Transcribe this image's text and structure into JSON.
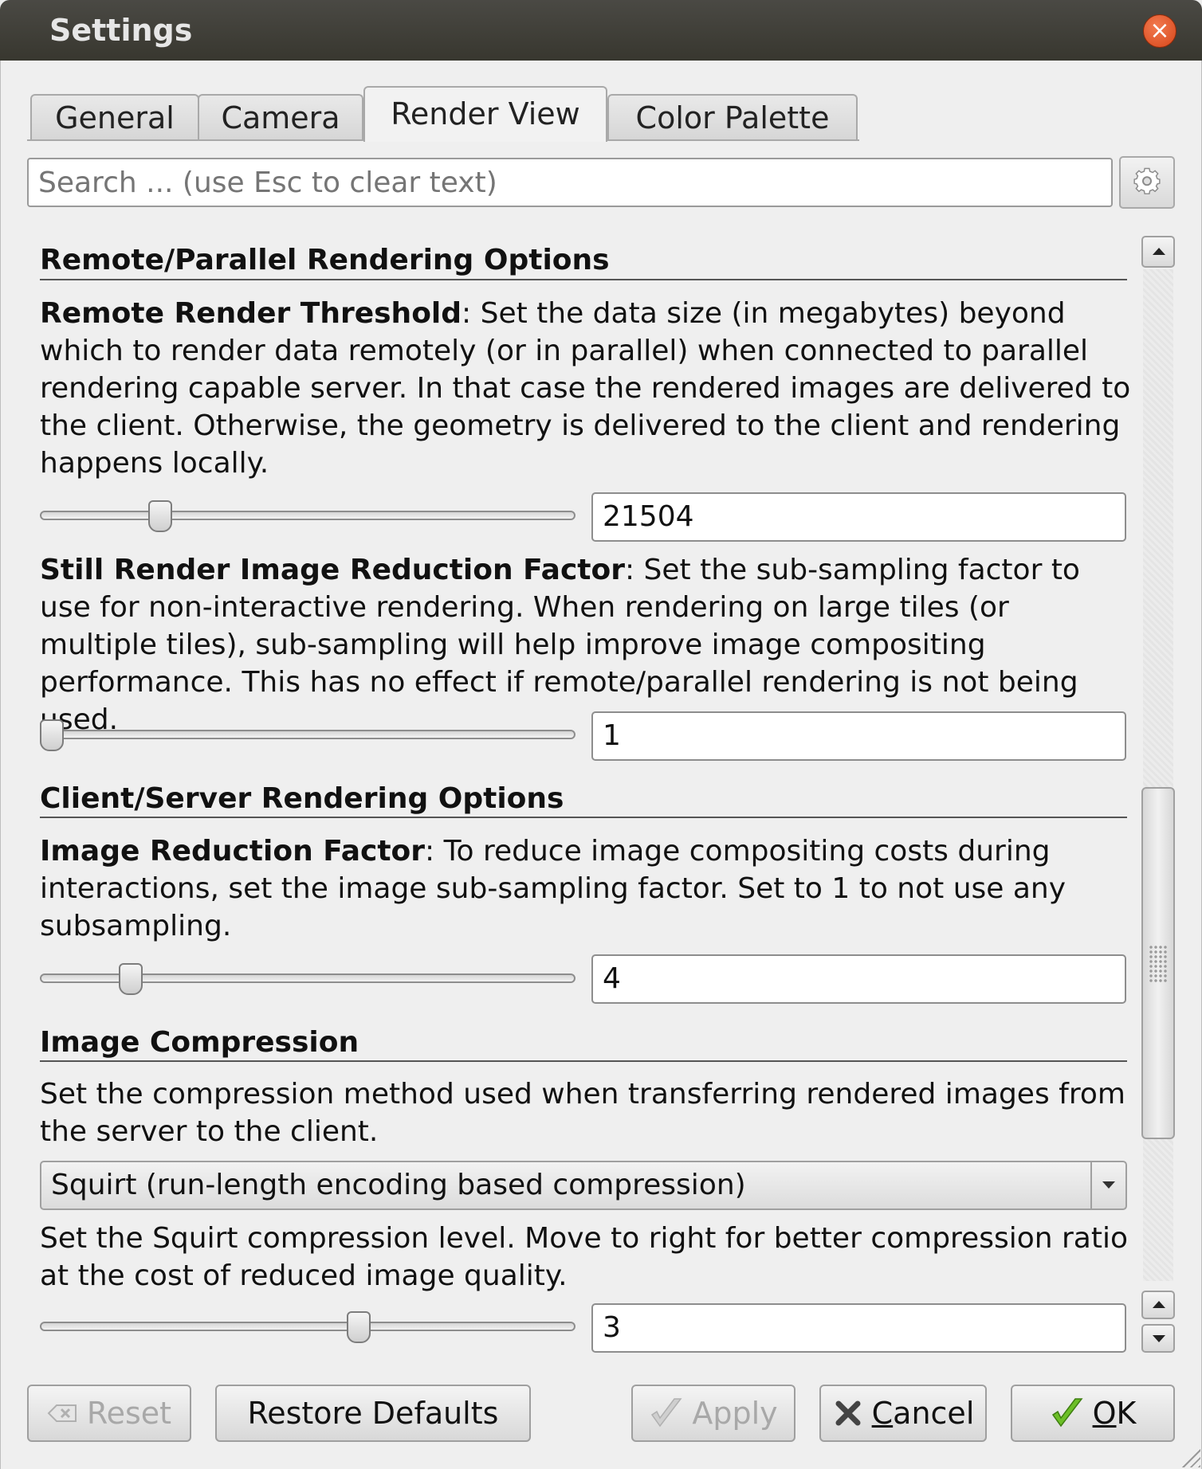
{
  "window": {
    "title": "Settings",
    "close_glyph": "×"
  },
  "tabs": [
    {
      "label": "General",
      "active": false
    },
    {
      "label": "Camera",
      "active": false
    },
    {
      "label": "Render View",
      "active": true
    },
    {
      "label": "Color Palette",
      "active": false
    }
  ],
  "search": {
    "value": "",
    "placeholder": "Search ... (use Esc to clear text)"
  },
  "sections": {
    "remote_parallel": {
      "title": "Remote/Parallel Rendering Options",
      "remote_render_threshold": {
        "label": "Remote Render Threshold",
        "description": ": Set the data size (in megabytes) beyond which to render data remotely (or in parallel) when connected to parallel rendering capable server. In that case the rendered images are delivered to the client. Otherwise, the geometry is delivered to the client and rendering happens locally.",
        "value": "21504",
        "slider_fraction": 0.22
      },
      "still_render_reduction": {
        "label": "Still Render Image Reduction Factor",
        "description": ": Set the sub-sampling factor to use for non-interactive rendering. When rendering on large tiles (or multiple tiles), sub-sampling will help improve image compositing performance. This has no effect if remote/parallel rendering is not being used.",
        "value": "1",
        "slider_fraction": 0.02
      }
    },
    "client_server": {
      "title": "Client/Server Rendering Options",
      "image_reduction": {
        "label": "Image Reduction Factor",
        "description": ": To reduce image compositing costs during interactions, set the image sub-sampling factor. Set to 1 to not use any subsampling.",
        "value": "4",
        "slider_fraction": 0.17
      }
    },
    "image_compression": {
      "title": "Image Compression",
      "description": "Set the compression method used when transferring rendered images from the server to the client.",
      "method_selected": "Squirt (run-length encoding based compression)",
      "squirt_description": "Set the Squirt compression level. Move to right for better compression ratio at the cost of reduced image quality.",
      "squirt_value": "3",
      "slider_fraction": 0.6
    }
  },
  "buttons": {
    "reset": "Reset",
    "restore_defaults": "Restore Defaults",
    "apply": "Apply",
    "cancel": "Cancel",
    "ok": "OK"
  },
  "colors": {
    "titlebar": "#3c3b37",
    "close_button": "#e05a2b",
    "check_green": "#5aa21b"
  }
}
